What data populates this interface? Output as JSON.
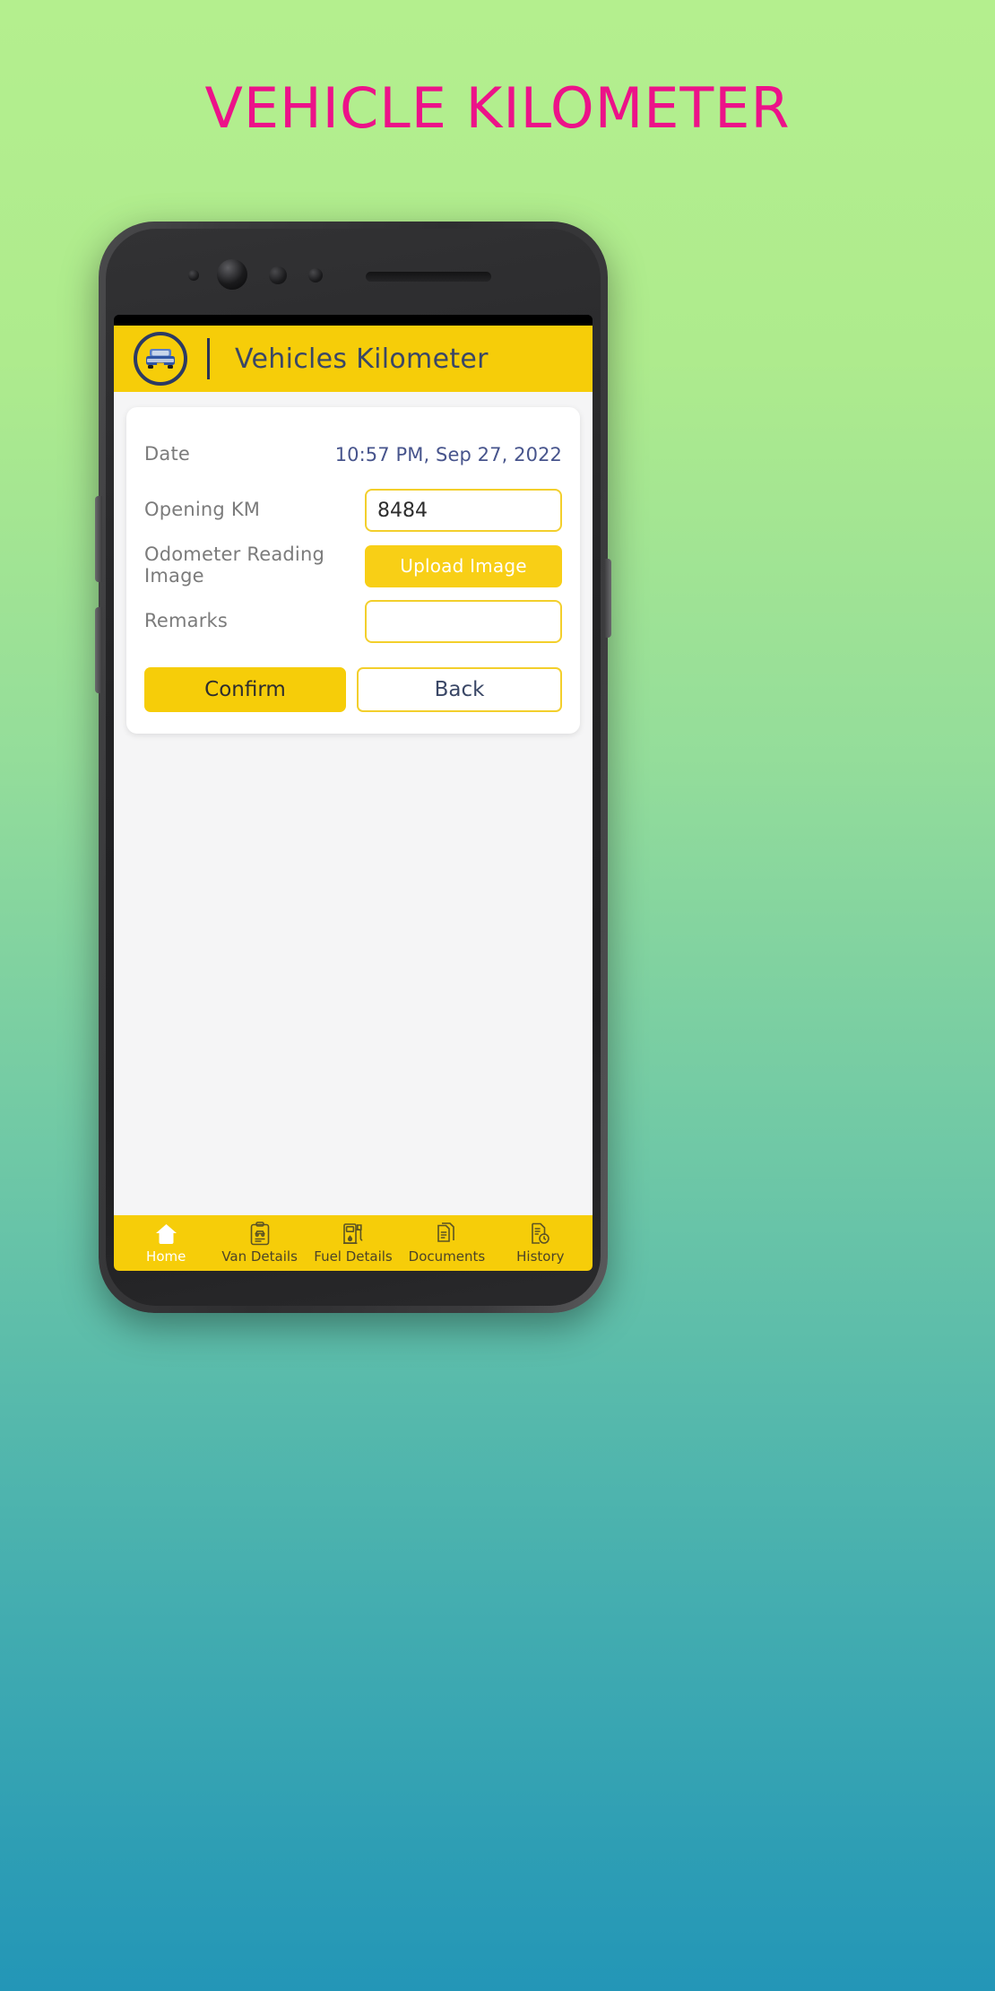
{
  "poster": {
    "title": "VEHICLE KILOMETER",
    "title_color": "#ec1289",
    "background_top": "#b4ef8e",
    "background_bottom": "#2396b7"
  },
  "app": {
    "header": {
      "title": "Vehicles Kilometer",
      "logo_icon": "vehicle-suv-icon",
      "accent_color": "#f6cd09",
      "title_color": "#3a4766"
    },
    "form": {
      "rows": [
        {
          "label": "Date",
          "type": "static",
          "value": "10:57 PM, Sep 27, 2022"
        },
        {
          "label": "Opening KM",
          "type": "input",
          "value": "8484",
          "placeholder": ""
        },
        {
          "label": "Odometer Reading Image",
          "type": "button",
          "value": "Upload Image"
        },
        {
          "label": "Remarks",
          "type": "input",
          "value": "",
          "placeholder": ""
        }
      ],
      "confirm_label": "Confirm",
      "back_label": "Back"
    },
    "tabbar": {
      "items": [
        {
          "label": "Home",
          "icon": "home-icon",
          "active": true
        },
        {
          "label": "Van Details",
          "icon": "clipboard-van-icon",
          "active": false
        },
        {
          "label": "Fuel Details",
          "icon": "fuel-pump-icon",
          "active": false
        },
        {
          "label": "Documents",
          "icon": "documents-icon",
          "active": false
        },
        {
          "label": "History",
          "icon": "history-document-icon",
          "active": false
        }
      ]
    }
  },
  "android_nav": {
    "recents": "recents-icon",
    "home": "home-square-icon",
    "back": "back-chevron-icon"
  }
}
